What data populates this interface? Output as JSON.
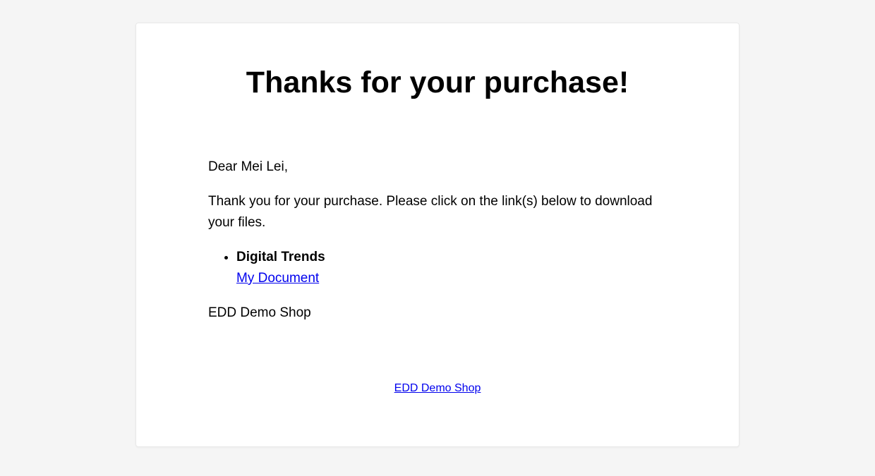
{
  "title": "Thanks for your purchase!",
  "greeting": "Dear Mei Lei,",
  "message": "Thank you for your purchase. Please click on the link(s) below to download your files.",
  "downloads": {
    "product_name": "Digital Trends",
    "file_label": "My Document"
  },
  "signature": "EDD Demo Shop",
  "footer": {
    "link_label": "EDD Demo Shop"
  }
}
